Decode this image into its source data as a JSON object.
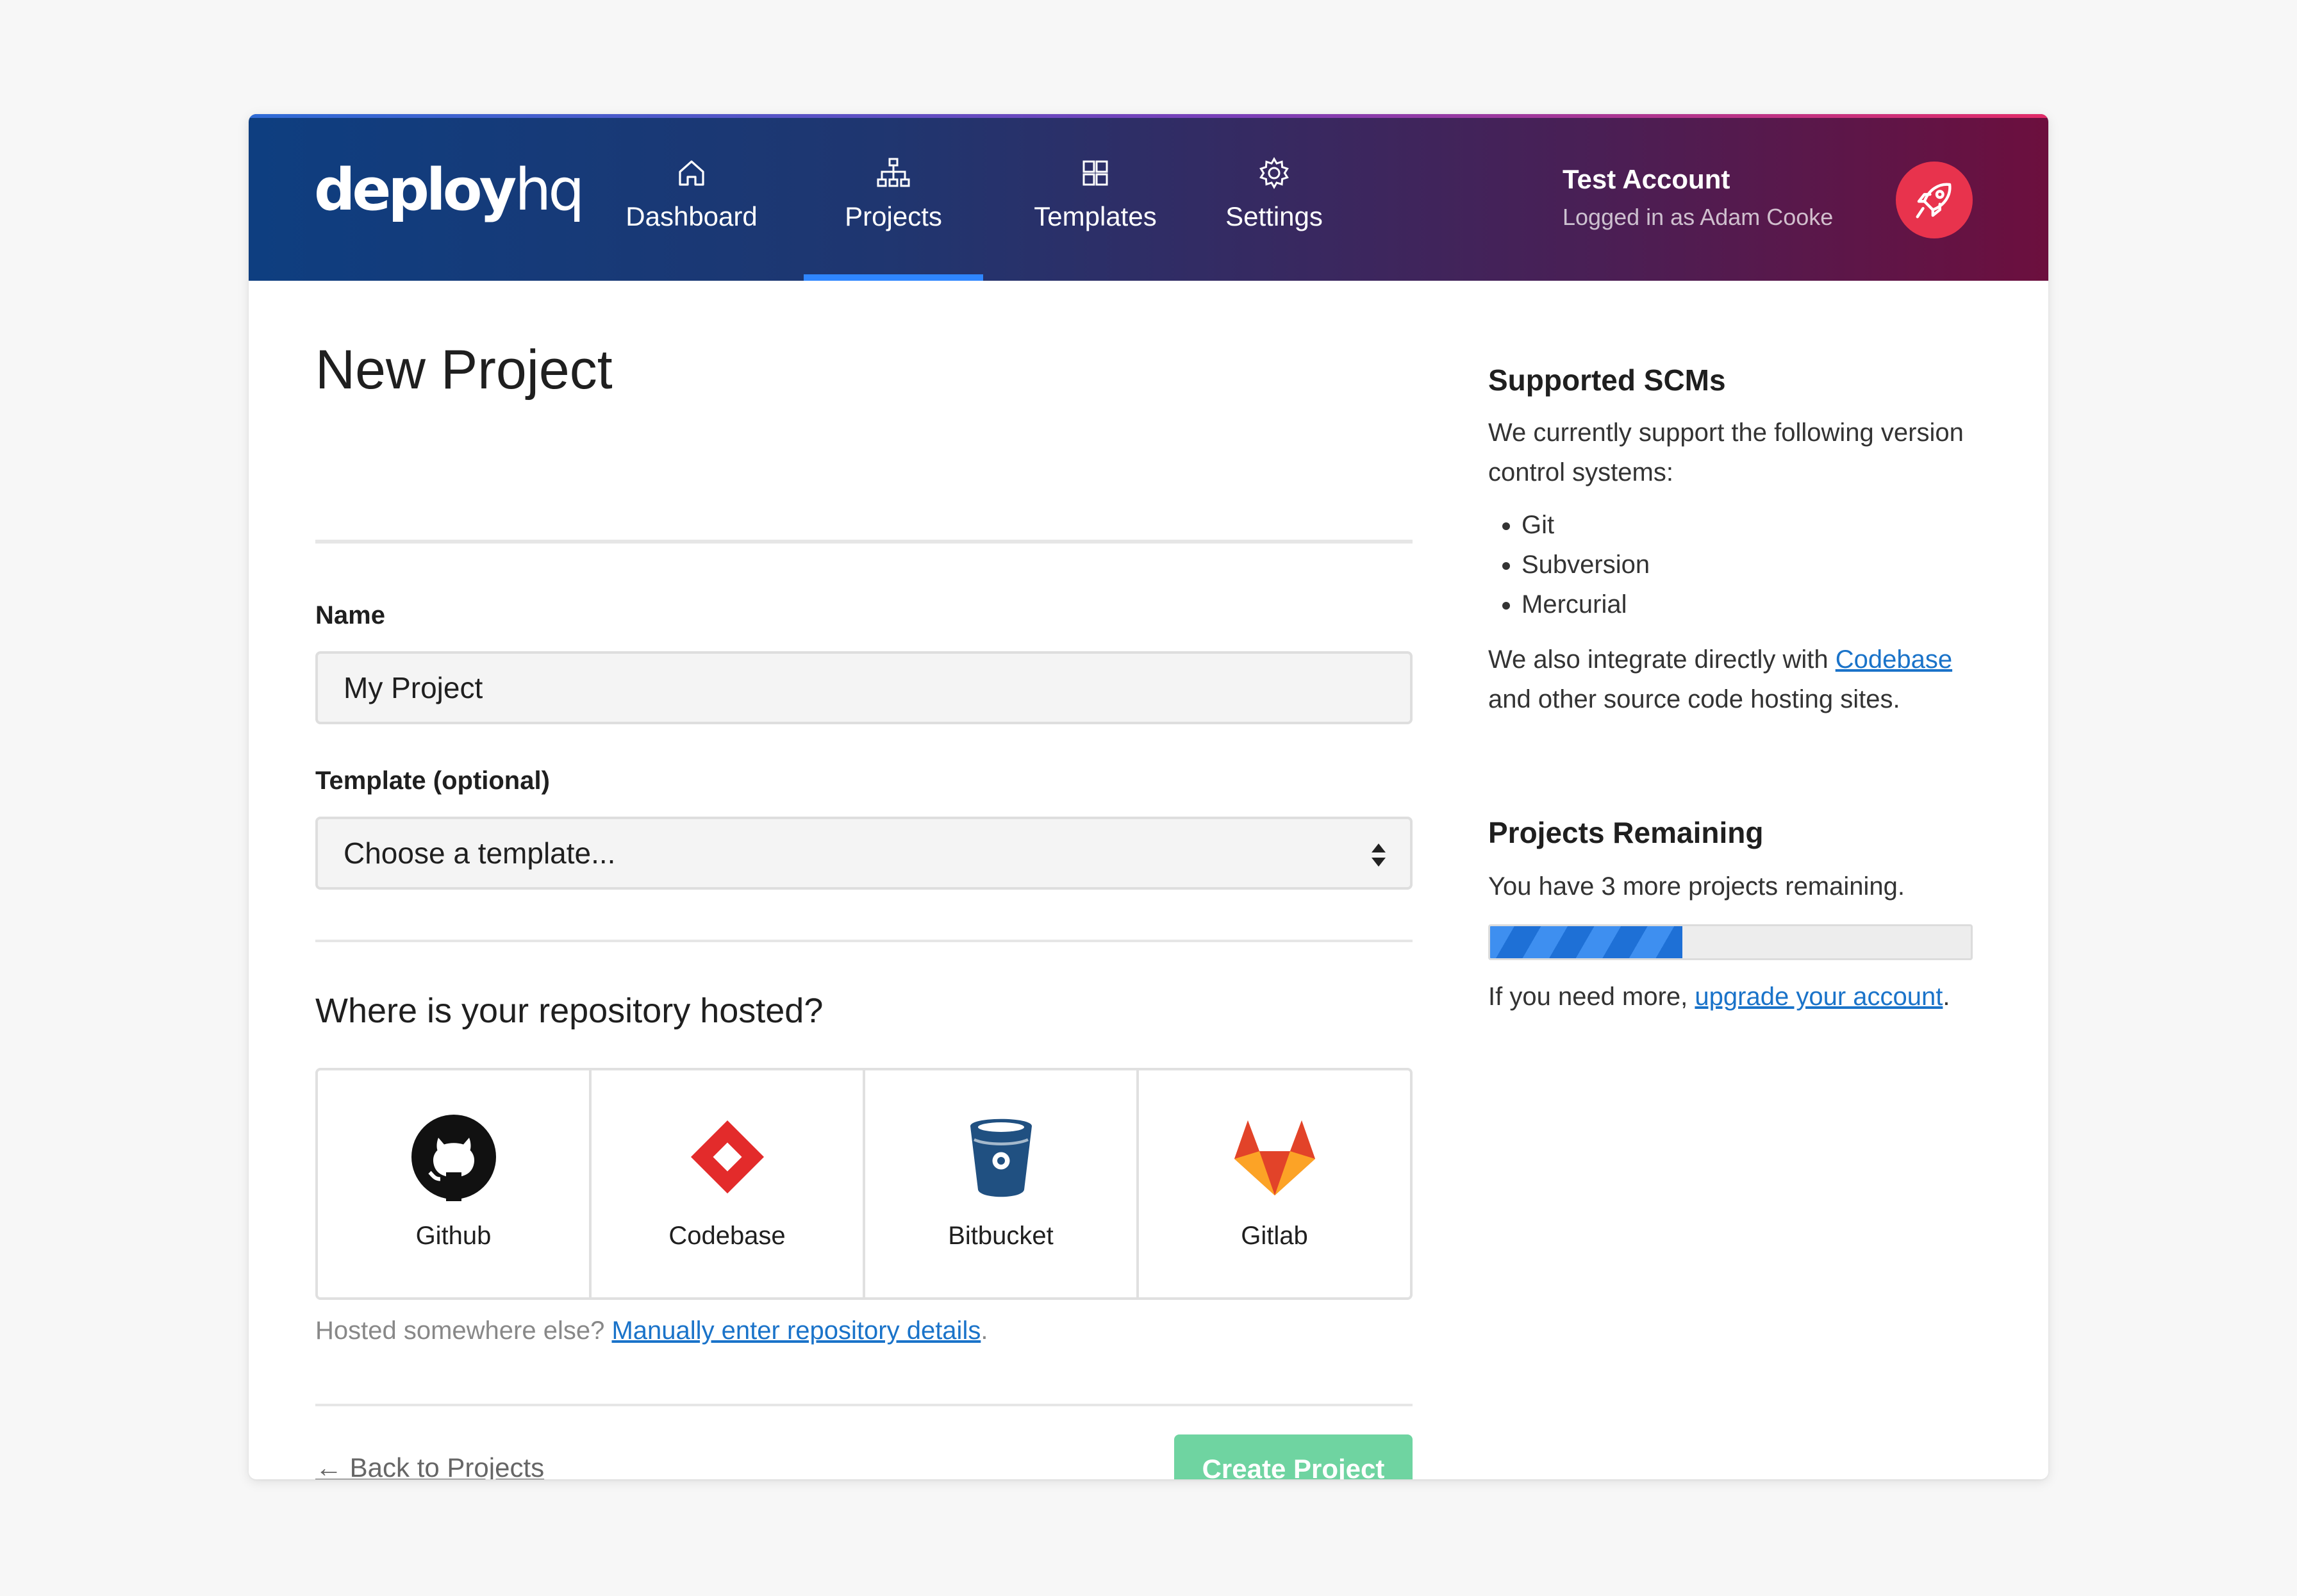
{
  "header": {
    "logo_bold": "deploy",
    "logo_light": "hq",
    "nav": [
      {
        "label": "Dashboard",
        "icon": "home-icon",
        "active": false
      },
      {
        "label": "Projects",
        "icon": "sitemap-icon",
        "active": true
      },
      {
        "label": "Templates",
        "icon": "grid-icon",
        "active": false
      },
      {
        "label": "Settings",
        "icon": "gear-icon",
        "active": false
      }
    ],
    "account_name": "Test Account",
    "account_sub": "Logged in as Adam Cooke",
    "avatar_icon": "rocket-icon"
  },
  "main": {
    "title": "New Project",
    "name_label": "Name",
    "name_value": "My Project",
    "template_label": "Template (optional)",
    "template_value": "Choose a template...",
    "repo_title": "Where is your repository hosted?",
    "hosts": [
      {
        "label": "Github",
        "icon": "github-icon"
      },
      {
        "label": "Codebase",
        "icon": "codebase-icon"
      },
      {
        "label": "Bitbucket",
        "icon": "bitbucket-icon"
      },
      {
        "label": "Gitlab",
        "icon": "gitlab-icon"
      }
    ],
    "hint_prefix": "Hosted somewhere else?",
    "hint_link": "Manually enter repository details",
    "hint_suffix": ".",
    "back_link": "← Back to Projects",
    "create_button": "Create Project"
  },
  "sidebar": {
    "scm_title": "Supported SCMs",
    "scm_intro": "We currently support the following version control systems:",
    "scms": [
      "Git",
      "Subversion",
      "Mercurial"
    ],
    "integrate_prefix": "We also integrate directly with",
    "integrate_link": "Codebase",
    "integrate_suffix": "and other source code hosting sites.",
    "remaining_title": "Projects Remaining",
    "remaining_text": "You have 3 more projects remaining.",
    "remaining_fraction": 0.4,
    "upgrade_prefix": "If you need more,",
    "upgrade_link": "upgrade your account",
    "upgrade_suffix": "."
  },
  "colors": {
    "accent": "#2f86ff",
    "link": "#1a73c9",
    "create_button": "#6fd4a1",
    "avatar": "#e8334d",
    "progress": "#1e70d6"
  }
}
